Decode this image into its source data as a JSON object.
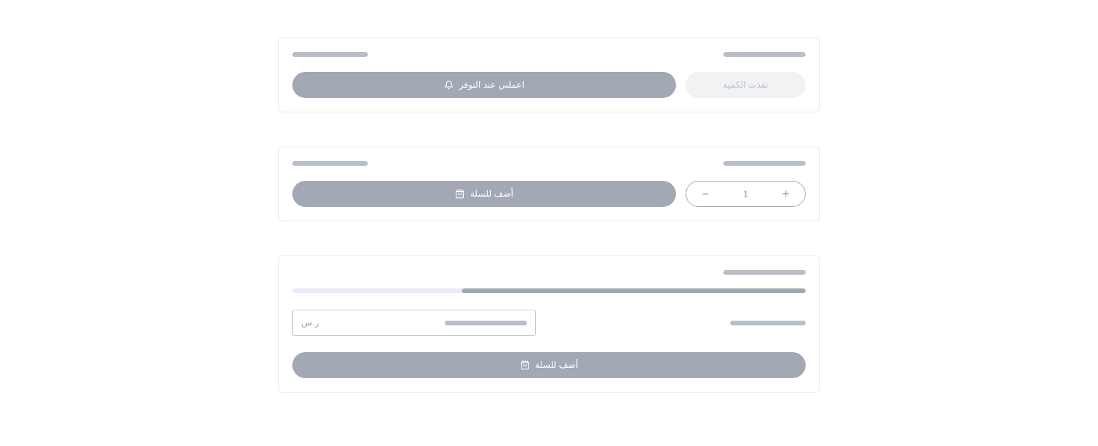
{
  "card1": {
    "notify_label": "اعملني عند التوفر",
    "out_of_stock_label": "نفذت الكمية"
  },
  "card2": {
    "add_to_cart_label": "أضف للسلة",
    "quantity": "1"
  },
  "card3": {
    "progress_percent": 67,
    "currency": "ر.س",
    "add_to_cart_label": "أضف للسلة"
  }
}
